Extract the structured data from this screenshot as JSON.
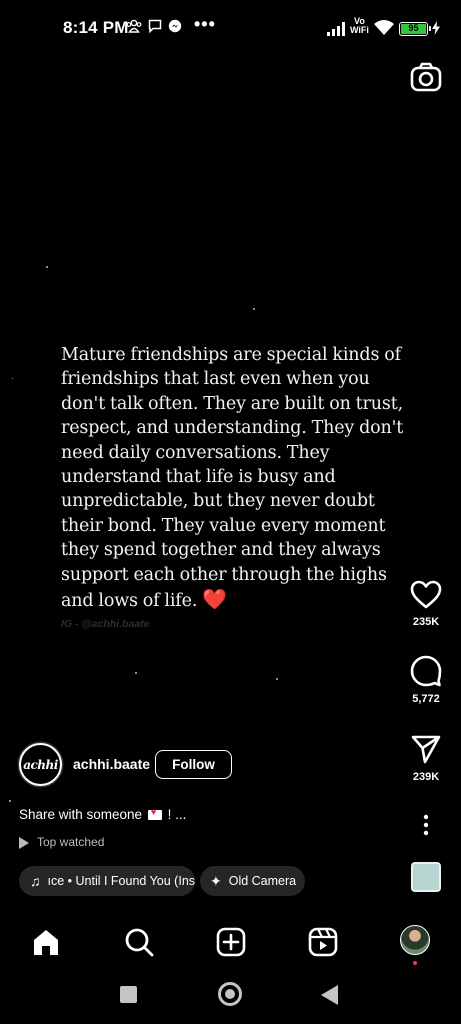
{
  "status_bar": {
    "time": "8:14 PM",
    "network_label_top": "Vo",
    "network_label_bottom": "WiFi",
    "battery": "95"
  },
  "post": {
    "quote": "Mature friendships are special kinds of friendships that last even when you don't talk often. They are built on trust, respect, and understanding. They don't need daily conversations. They understand that life is busy and unpredictable, but they never doubt their bond. They value every moment they spend together and they always support each other through the highs and lows of life.",
    "quote_emoji": "❤️",
    "watermark": "IG - @achhi.baate"
  },
  "actions": {
    "likes": "235K",
    "comments": "5,772",
    "shares": "239K"
  },
  "author": {
    "avatar_text": "achhi",
    "username": "achhi.baate",
    "follow_label": "Follow"
  },
  "caption": {
    "text_before": "Share with someone",
    "text_after": "! ..."
  },
  "top_watched_label": "Top watched",
  "audio": {
    "music_label": "ıce • Until I Found You (Instr",
    "camera_label": "Old Camera"
  },
  "colors": {
    "background": "#000000",
    "heart_red": "#d4202c",
    "battery_green": "#32c738"
  },
  "icons": {
    "nav": [
      "home-icon",
      "search-icon",
      "create-icon",
      "reels-icon",
      "profile-avatar"
    ],
    "system": [
      "recents-button",
      "home-button",
      "back-button"
    ]
  }
}
